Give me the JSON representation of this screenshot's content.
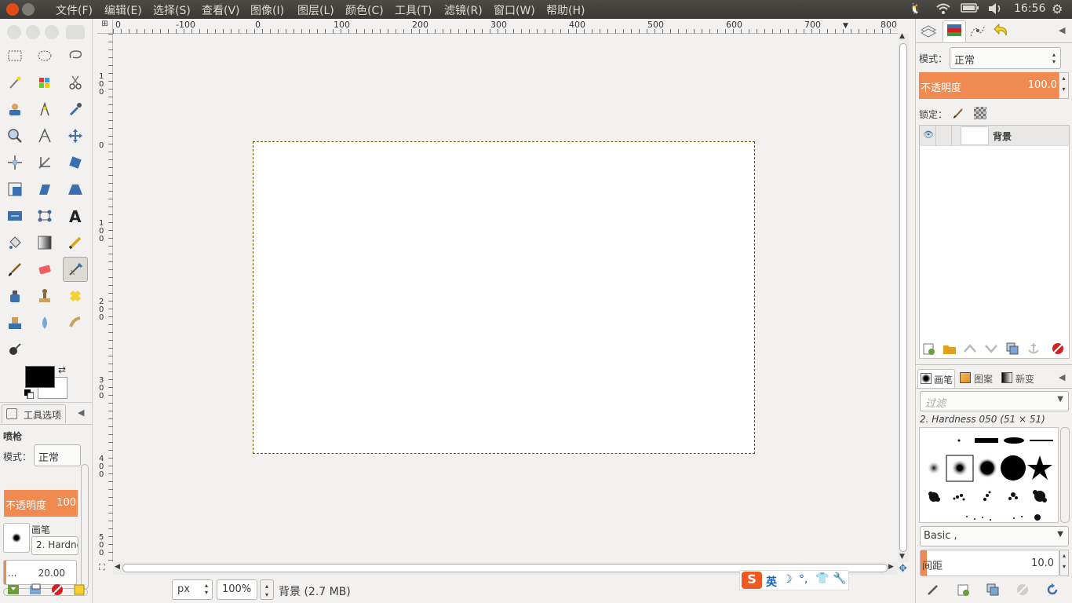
{
  "menubar": {
    "items": [
      "文件(F)",
      "编辑(E)",
      "选择(S)",
      "查看(V)",
      "图像(I)",
      "图层(L)",
      "颜色(C)",
      "工具(T)",
      "滤镜(R)",
      "窗口(W)",
      "帮助(H)"
    ],
    "clock": "16:56"
  },
  "ruler": {
    "top_labels": [
      "0",
      "-100",
      "0",
      "100",
      "200",
      "300",
      "400",
      "500",
      "600",
      "700",
      "800"
    ],
    "left_labels": [
      "1\n0\n0",
      "0",
      "1\n0\n0",
      "2\n0\n0",
      "3\n0\n0",
      "4\n0\n0",
      "5\n0\n0"
    ]
  },
  "tool_options": {
    "tab_label": "工具选项",
    "tool_name": "喷枪",
    "mode_label": "模式：",
    "mode_value": "正常",
    "opacity_label": "不透明度",
    "opacity_value": "100",
    "brush_label": "画笔",
    "brush_value": "2. Hardne",
    "size_value": "20.00",
    "size_prefix": "..."
  },
  "status": {
    "unit": "px",
    "zoom": "100%",
    "info": "背景 (2.7 MB)"
  },
  "layers": {
    "mode_label": "模式：",
    "mode_value": "正常",
    "opacity_label": "不透明度",
    "opacity_value": "100.0",
    "opacity_fraction": 1.0,
    "lock_label": "锁定：",
    "layer_name": "背景"
  },
  "brushes": {
    "tabs": [
      "画笔",
      "图案",
      "新变"
    ],
    "filter_placeholder": "过滤",
    "selected_brush": "2. Hardness 050 (51 × 51)",
    "preset": "Basic ,",
    "spacing_label": "间距",
    "spacing_value": "10.0"
  },
  "ime": {
    "lang": "英"
  },
  "colors": {
    "accent": "#f08a50",
    "menubar": "#3c3b37",
    "foreground": "#000000",
    "background": "#ffffff"
  }
}
